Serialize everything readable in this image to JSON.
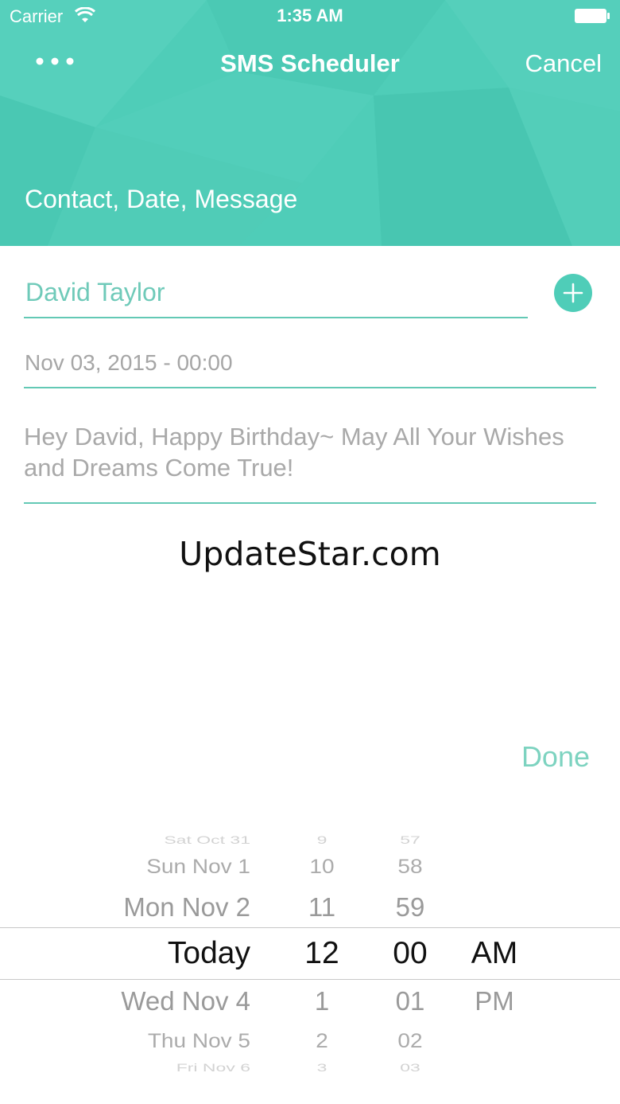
{
  "colors": {
    "accent": "#4fcdb8",
    "underline": "#63c9b5",
    "text_muted": "#a6a6a6"
  },
  "status_bar": {
    "carrier": "Carrier",
    "time": "1:35 AM"
  },
  "nav": {
    "title": "SMS Scheduler",
    "cancel_label": "Cancel",
    "more_icon": "more-dots-icon"
  },
  "header": {
    "section_title": "Contact, Date, Message"
  },
  "form": {
    "contact_value": "David Taylor",
    "add_icon": "plus-icon",
    "date_value": "Nov 03, 2015 - 00:00",
    "message_value": "Hey David, Happy Birthday~ May All Your Wishes and Dreams Come True!"
  },
  "watermark": "UpdateStar.com",
  "done_label": "Done",
  "picker": {
    "days": [
      "Sat Oct 31",
      "Sun Nov 1",
      "Mon Nov 2",
      "Today",
      "Wed Nov 4",
      "Thu Nov 5",
      "Fri Nov 6"
    ],
    "hours": [
      "9",
      "10",
      "11",
      "12",
      "1",
      "2",
      "3"
    ],
    "minutes": [
      "57",
      "58",
      "59",
      "00",
      "01",
      "02",
      "03"
    ],
    "ampm": [
      "AM",
      "PM"
    ],
    "selected": {
      "day": "Today",
      "hour": "12",
      "minute": "00",
      "ampm": "AM"
    }
  }
}
